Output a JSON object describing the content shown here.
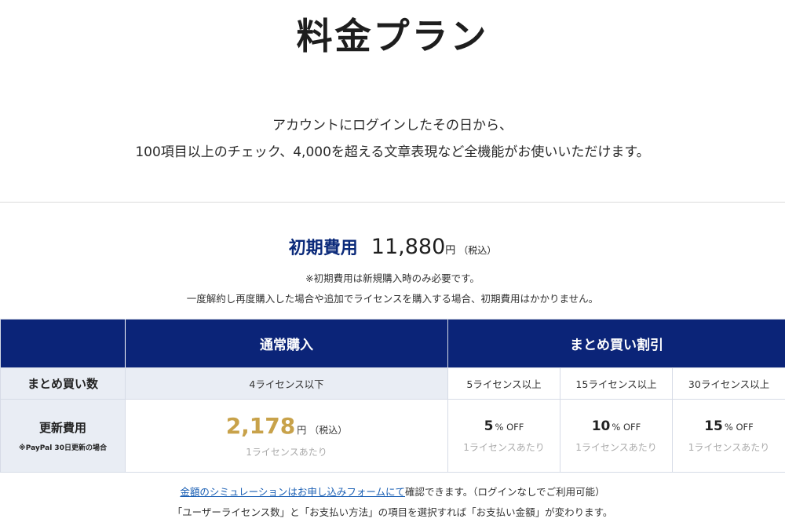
{
  "page": {
    "title": "料金プラン",
    "intro_line1": "アカウントにログインしたその日から、",
    "intro_line2": "100項目以上のチェック、4,000を超える文章表現など全機能がお使いいただけます。"
  },
  "initial_fee": {
    "label": "初期費用",
    "amount": "11,880",
    "unit": "円",
    "tax": "（税込）",
    "note1": "※初期費用は新規購入時のみ必要です。",
    "note2": "一度解約し再度購入した場合や追加でライセンスを購入する場合、初期費用はかかりません。"
  },
  "table": {
    "header_normal": "通常購入",
    "header_bulk": "まとめ買い割引",
    "row_count_label": "まとめ買い数",
    "row_fee_label": "更新費用",
    "row_fee_sub": "※PayPal 30日更新の場合",
    "normal": {
      "count": "4ライセンス以下",
      "price": "2,178",
      "unit": "円",
      "tax": "（税込）",
      "per": "1ライセンスあたり"
    },
    "bulk": [
      {
        "count": "5ライセンス以上",
        "value": "5",
        "unit": "% OFF",
        "per": "1ライセンスあたり"
      },
      {
        "count": "15ライセンス以上",
        "value": "10",
        "unit": "% OFF",
        "per": "1ライセンスあたり"
      },
      {
        "count": "30ライセンス以上",
        "value": "15",
        "unit": "% OFF",
        "per": "1ライセンスあたり"
      }
    ]
  },
  "footer": {
    "sim_link": "金額のシミュレーションはお申し込みフォームにて",
    "sim_text": "確認できます。（ログインなしでご利用可能）",
    "sim_line2": "「ユーザーライセンス数」と「お支払い方法」の項目を選択すれば「お支払い金額」が変わります。"
  },
  "colors": {
    "header_bg": "#0b2478",
    "accent_gold": "#c8a24a",
    "label_navy": "#0b2a7a",
    "row_label_bg": "#e9edf4",
    "link": "#1a5fb4"
  }
}
